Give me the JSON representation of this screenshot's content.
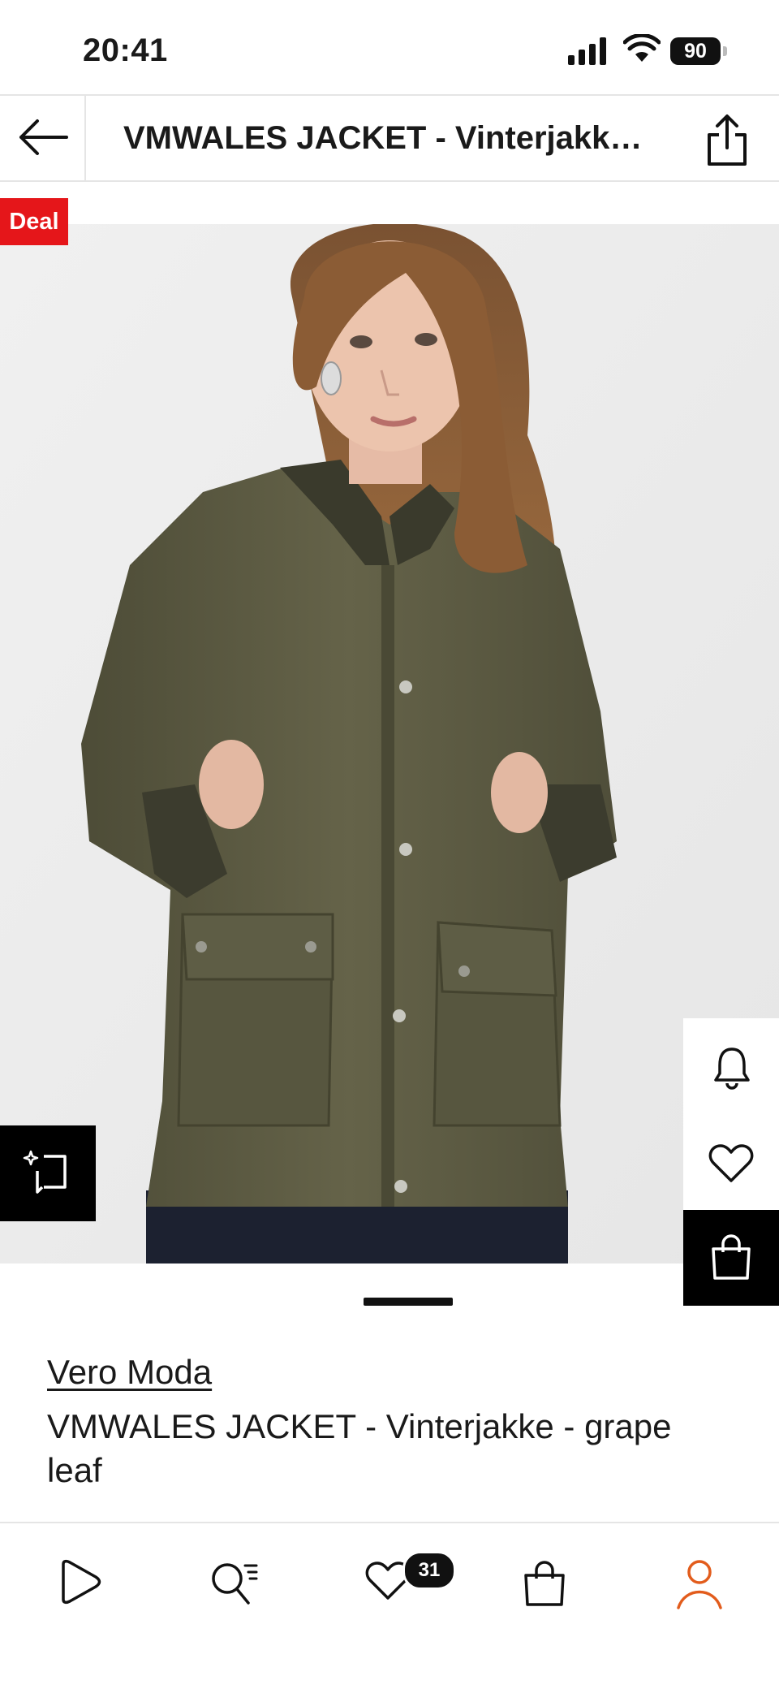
{
  "status_bar": {
    "time": "20:41",
    "battery": "90"
  },
  "header": {
    "title": "VMWALES JACKET - Vinterjakke - grape leaf"
  },
  "product": {
    "deal_label": "Deal",
    "brand": "Vero Moda",
    "name": "VMWALES JACKET - Vinterjakke - grape leaf",
    "image_description_icon": "product-photo"
  },
  "side_actions": {
    "notify_icon": "bell-icon",
    "wishlist_icon": "heart-icon",
    "bag_icon": "bag-icon",
    "similar_icon": "similar-items-icon"
  },
  "tab_bar": {
    "items": [
      "discover",
      "search",
      "wishlist",
      "bag",
      "profile"
    ],
    "wishlist_count": "31"
  },
  "colors": {
    "deal_red": "#e5161a",
    "profile_active": "#e25c1c",
    "jacket": "#5b5a42"
  }
}
